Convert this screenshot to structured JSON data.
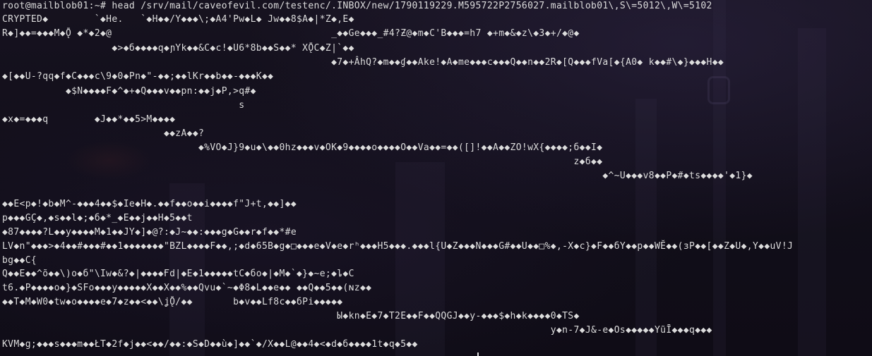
{
  "terminal": {
    "command_line": "root@mailblob01:~# head /srv/mail/caveofevil.com/testenc/.INBOX/new/1790119229.M595722P2756027.mailblob01\\,S\\=5012\\,W\\=5102",
    "lines": [
      "CRYPTED◆        `◆He.   `◆H◆◆/Y◆◆◆\\;◆A4'Pw◆L◆ Jw◆◆8$A◆|*Z◆,E◆",
      "R◆]◆◆=◆◆◆M◆Ǭ ◆*◆2◆@                                      _◆◆Ge◆◆◆_#4?Ƶ@◆m◆C'B◆◆◆=h7 ◆+m◆&◆z\\◆3◆+/◆@◆",
      "                   ◆>◆б◆◆◆◆q◆ɲYk◆◆&C◆c!◆U6*8b◆◆S◆◆* XǬC◆Z|`◆◆",
      "                                                         ◆7◆+ÂhQ?◆m◆◆ɠ◆◆Ake!◆A◆me◆◆◆c◆◆◆Q◆◆n◆◆2R◆[Q◆◆◆fVa[◆{A0◆ k◆◆#\\◆}◆◆◆H◆◆",
      "◆[◆◆U-?qq◆f◆C◆◆◆c\\9◆0◆Pn◆\"-◆◆;◆◆lKr◆◆b◆◆-◆◆◆K◆◆",
      "           ◆$N◆◆◆◆F◆^◆+◆Q◆◆◆v◆◆pn:◆◆j◆P,>q#◆",
      "                                         s",
      "◆x◆=◆◆◆q        ◆J◆◆*◆◆5>M◆◆◆◆",
      "                            ◆◆zA◆◆?",
      "                                  ◆%VO◆J}9◆u◆\\◆◆0hz◆◆◆v◆OK◆9◆◆◆◆o◆◆◆◆O◆◆Va◆◆=◆◆([]!◆◆A◆◆ZO!wX{◆◆◆◆;б◆◆I◆",
      "                                                                                                   z◆б◆◆",
      "                                                                                                        ◆^~U◆◆◆v8◆◆P◆#◆ts◆◆◆◆'◆1}◆",
      "",
      "◆◆E<p◆!◆b◆M^-◆◆◆4◆◆$◆Ie◆H◆.◆◆f◆◆o◆◆i◆◆◆◆f\"J+t,◆◆]◆◆",
      "p◆◆◆GÇ◆,◆s◆◆l◆;◆б◆*_◆E◆◆j◆◆H◆5◆◆t",
      "◆87◆◆◆◆?L◆◆y◆◆◆◆M◆1◆◆JY◆]◆@?:◆J~◆◆:◆◆◆g◆G◆◆r◆f◆◆*#e",
      "LV◆n\"◆◆◆>◆4◆◆#◆◆◆#◆◆1◆◆◆◆◆◆◆\"BZL◆◆◆◆F◆◆,;◆d◆65B◆g◆□◆◆◆e◆V◆e◆rʰ◆◆◆H5◆◆◆.◆◆◆l{U◆Z◆◆◆N◆◆◆G#◆◆U◆◆□%◆,-X◆c}◆F◆◆бY◆◆p◆◆WĔ◆◆(зP◆◆[◆◆Z◆U◆,Y◆◆uV!J",
      "bg◆◆C{",
      "Q◆◆E◆◆^õ◆◆\\)o◆б\"\\Iw◆&?◆|◆◆◆◆Ғd|◆E◆1◆◆◆◆◆tC◆бo◆|◆M◆`◆}◆~e;◆ȴ◆C",
      "t6.◆P◆◆◆◆o◆}◆SFo◆◆◆y◆◆◆◆◆X◆◆X◆◆%◆◆Qvu◆`~◆Φ8◆L◆◆e◆◆ ◆◆Q◆◆5◆◆(ɴz◆◆",
      "◆◆T◆M◆W0◆tw◆o◆◆◆◆e◆7◆z◆◆<◆◆\\ʝǬ/◆◆       b◆v◆◆Lf8c◆◆бPi◆◆◆◆◆",
      "                                                          Ы◆kn◆E◆7◆T2E◆◆F◆◆QQGJ◆◆y-◆◆◆$◆h◆k◆◆◆◆0◆TS◆",
      "                                                                                               y◆n-7◆J&-e◆Os◆◆◆◆◆YũĪ◆◆◆q◆◆◆",
      "KVM◆g;◆◆◆s◆◆◆m◆◆ŁT◆2f◆j◆◆<◆◆/◆◆:◆S◆D◆◆ù◆]◆◆`◆/X◆◆L@◆◆4◆<◆d◆б◆◆◆◆1t◆q◆5◆◆"
    ]
  }
}
